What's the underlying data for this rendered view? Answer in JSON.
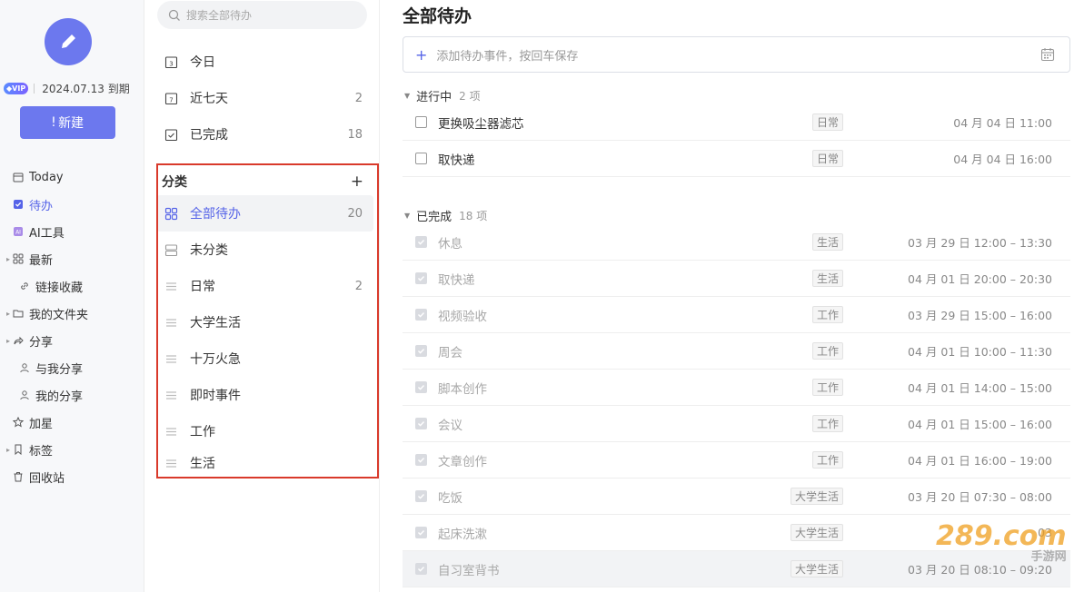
{
  "nav": {
    "vip_label": "VIP",
    "expiry": "2024.07.13 到期",
    "new_button": "新建",
    "items": [
      {
        "label": "Today",
        "icon": "calendar-icon",
        "caret": false,
        "indent": 0,
        "active": false
      },
      {
        "label": "待办",
        "icon": "todo-check-icon",
        "caret": false,
        "indent": 0,
        "active": true
      },
      {
        "label": "AI工具",
        "icon": "ai-icon",
        "caret": false,
        "indent": 0,
        "active": false
      },
      {
        "label": "最新",
        "icon": "grid-icon",
        "caret": true,
        "indent": 0,
        "active": false
      },
      {
        "label": "链接收藏",
        "icon": "link-icon",
        "caret": false,
        "indent": 1,
        "active": false
      },
      {
        "label": "我的文件夹",
        "icon": "folder-icon",
        "caret": true,
        "indent": 0,
        "active": false
      },
      {
        "label": "分享",
        "icon": "share-icon",
        "caret": true,
        "indent": 0,
        "active": false
      },
      {
        "label": "与我分享",
        "icon": "user-icon",
        "caret": false,
        "indent": 1,
        "active": false
      },
      {
        "label": "我的分享",
        "icon": "user-icon",
        "caret": false,
        "indent": 1,
        "active": false
      },
      {
        "label": "加星",
        "icon": "star-icon",
        "caret": false,
        "indent": 0,
        "active": false
      },
      {
        "label": "标签",
        "icon": "bookmark-icon",
        "caret": true,
        "indent": 0,
        "active": false
      },
      {
        "label": "回收站",
        "icon": "trash-icon",
        "caret": false,
        "indent": 0,
        "active": false
      }
    ]
  },
  "mid": {
    "search_placeholder": "搜索全部待办",
    "quick": [
      {
        "label": "今日",
        "count": "",
        "icon": "calendar-day-icon"
      },
      {
        "label": "近七天",
        "count": "2",
        "icon": "calendar-week-icon"
      },
      {
        "label": "已完成",
        "count": "18",
        "icon": "calendar-check-icon"
      }
    ],
    "category_title": "分类",
    "categories": [
      {
        "label": "全部待办",
        "count": "20",
        "icon": "all-grid-icon",
        "selected": true
      },
      {
        "label": "未分类",
        "count": "",
        "icon": "uncategorized-icon",
        "selected": false
      },
      {
        "label": "日常",
        "count": "2",
        "icon": "list-icon",
        "selected": false
      },
      {
        "label": "大学生活",
        "count": "",
        "icon": "list-icon",
        "selected": false
      },
      {
        "label": "十万火急",
        "count": "",
        "icon": "list-icon",
        "selected": false
      },
      {
        "label": "即时事件",
        "count": "",
        "icon": "list-icon",
        "selected": false
      },
      {
        "label": "工作",
        "count": "",
        "icon": "list-icon",
        "selected": false
      },
      {
        "label": "生活",
        "count": "",
        "icon": "list-icon",
        "selected": false
      }
    ]
  },
  "main": {
    "title": "全部待办",
    "add_placeholder": "添加待办事件，按回车保存",
    "in_progress": {
      "label": "进行中",
      "count": "2 项",
      "tasks": [
        {
          "name": "更换吸尘器滤芯",
          "tag": "日常",
          "date": "04 月 04 日 11:00"
        },
        {
          "name": "取快递",
          "tag": "日常",
          "date": "04 月 04 日 16:00"
        }
      ]
    },
    "completed": {
      "label": "已完成",
      "count": "18 项",
      "tasks": [
        {
          "name": "休息",
          "tag": "生活",
          "date": "03 月 29 日 12:00 – 13:30"
        },
        {
          "name": "取快递",
          "tag": "生活",
          "date": "04 月 01 日 20:00 – 20:30"
        },
        {
          "name": "视频验收",
          "tag": "工作",
          "date": "03 月 29 日 15:00 – 16:00"
        },
        {
          "name": "周会",
          "tag": "工作",
          "date": "04 月 01 日 10:00 – 11:30"
        },
        {
          "name": "脚本创作",
          "tag": "工作",
          "date": "04 月 01 日 14:00 – 15:00"
        },
        {
          "name": "会议",
          "tag": "工作",
          "date": "04 月 01 日 15:00 – 16:00"
        },
        {
          "name": "文章创作",
          "tag": "工作",
          "date": "04 月 01 日 16:00 – 19:00"
        },
        {
          "name": "吃饭",
          "tag": "大学生活",
          "date": "03 月 20 日 07:30 – 08:00"
        },
        {
          "name": "起床洗漱",
          "tag": "大学生活",
          "date": "03"
        },
        {
          "name": "自习室背书",
          "tag": "大学生活",
          "date": "03 月 20 日 08:10 – 09:20"
        }
      ]
    }
  },
  "watermark": {
    "big": "289.com",
    "small": "手游网"
  },
  "colors": {
    "accent": "#6c78ee",
    "highlight_box": "#d93a2b"
  }
}
